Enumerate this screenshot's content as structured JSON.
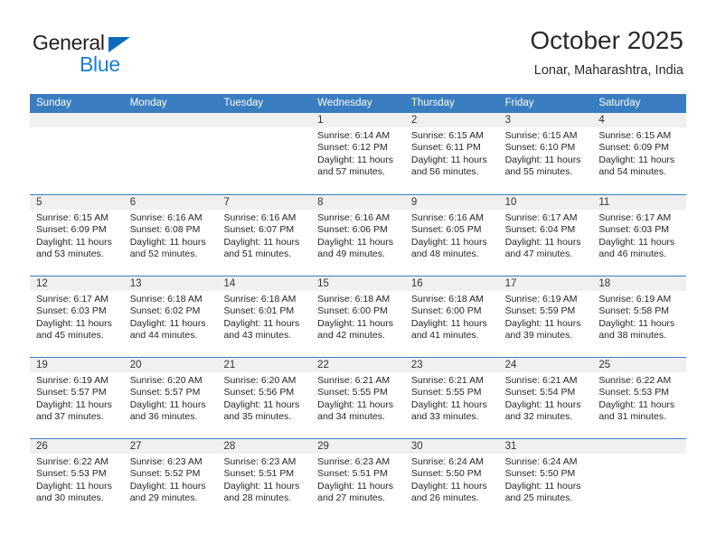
{
  "brand": {
    "name_top": "General",
    "name_bottom": "Blue",
    "accent_color": "#1a7fd4",
    "triangle_color": "#0d6cb9"
  },
  "header": {
    "title": "October 2025",
    "subtitle": "Lonar, Maharashtra, India"
  },
  "calendar": {
    "header_background": "#3a7dc0",
    "daynum_band_background": "#f0f0f0",
    "weekday_headers": [
      "Sunday",
      "Monday",
      "Tuesday",
      "Wednesday",
      "Thursday",
      "Friday",
      "Saturday"
    ],
    "weeks": [
      [
        {
          "day": "",
          "empty": true,
          "lines": []
        },
        {
          "day": "",
          "empty": true,
          "lines": []
        },
        {
          "day": "",
          "empty": true,
          "lines": []
        },
        {
          "day": "1",
          "empty": false,
          "lines": [
            "Sunrise: 6:14 AM",
            "Sunset: 6:12 PM",
            "Daylight: 11 hours",
            "and 57 minutes."
          ]
        },
        {
          "day": "2",
          "empty": false,
          "lines": [
            "Sunrise: 6:15 AM",
            "Sunset: 6:11 PM",
            "Daylight: 11 hours",
            "and 56 minutes."
          ]
        },
        {
          "day": "3",
          "empty": false,
          "lines": [
            "Sunrise: 6:15 AM",
            "Sunset: 6:10 PM",
            "Daylight: 11 hours",
            "and 55 minutes."
          ]
        },
        {
          "day": "4",
          "empty": false,
          "lines": [
            "Sunrise: 6:15 AM",
            "Sunset: 6:09 PM",
            "Daylight: 11 hours",
            "and 54 minutes."
          ]
        }
      ],
      [
        {
          "day": "5",
          "empty": false,
          "lines": [
            "Sunrise: 6:15 AM",
            "Sunset: 6:09 PM",
            "Daylight: 11 hours",
            "and 53 minutes."
          ]
        },
        {
          "day": "6",
          "empty": false,
          "lines": [
            "Sunrise: 6:16 AM",
            "Sunset: 6:08 PM",
            "Daylight: 11 hours",
            "and 52 minutes."
          ]
        },
        {
          "day": "7",
          "empty": false,
          "lines": [
            "Sunrise: 6:16 AM",
            "Sunset: 6:07 PM",
            "Daylight: 11 hours",
            "and 51 minutes."
          ]
        },
        {
          "day": "8",
          "empty": false,
          "lines": [
            "Sunrise: 6:16 AM",
            "Sunset: 6:06 PM",
            "Daylight: 11 hours",
            "and 49 minutes."
          ]
        },
        {
          "day": "9",
          "empty": false,
          "lines": [
            "Sunrise: 6:16 AM",
            "Sunset: 6:05 PM",
            "Daylight: 11 hours",
            "and 48 minutes."
          ]
        },
        {
          "day": "10",
          "empty": false,
          "lines": [
            "Sunrise: 6:17 AM",
            "Sunset: 6:04 PM",
            "Daylight: 11 hours",
            "and 47 minutes."
          ]
        },
        {
          "day": "11",
          "empty": false,
          "lines": [
            "Sunrise: 6:17 AM",
            "Sunset: 6:03 PM",
            "Daylight: 11 hours",
            "and 46 minutes."
          ]
        }
      ],
      [
        {
          "day": "12",
          "empty": false,
          "lines": [
            "Sunrise: 6:17 AM",
            "Sunset: 6:03 PM",
            "Daylight: 11 hours",
            "and 45 minutes."
          ]
        },
        {
          "day": "13",
          "empty": false,
          "lines": [
            "Sunrise: 6:18 AM",
            "Sunset: 6:02 PM",
            "Daylight: 11 hours",
            "and 44 minutes."
          ]
        },
        {
          "day": "14",
          "empty": false,
          "lines": [
            "Sunrise: 6:18 AM",
            "Sunset: 6:01 PM",
            "Daylight: 11 hours",
            "and 43 minutes."
          ]
        },
        {
          "day": "15",
          "empty": false,
          "lines": [
            "Sunrise: 6:18 AM",
            "Sunset: 6:00 PM",
            "Daylight: 11 hours",
            "and 42 minutes."
          ]
        },
        {
          "day": "16",
          "empty": false,
          "lines": [
            "Sunrise: 6:18 AM",
            "Sunset: 6:00 PM",
            "Daylight: 11 hours",
            "and 41 minutes."
          ]
        },
        {
          "day": "17",
          "empty": false,
          "lines": [
            "Sunrise: 6:19 AM",
            "Sunset: 5:59 PM",
            "Daylight: 11 hours",
            "and 39 minutes."
          ]
        },
        {
          "day": "18",
          "empty": false,
          "lines": [
            "Sunrise: 6:19 AM",
            "Sunset: 5:58 PM",
            "Daylight: 11 hours",
            "and 38 minutes."
          ]
        }
      ],
      [
        {
          "day": "19",
          "empty": false,
          "lines": [
            "Sunrise: 6:19 AM",
            "Sunset: 5:57 PM",
            "Daylight: 11 hours",
            "and 37 minutes."
          ]
        },
        {
          "day": "20",
          "empty": false,
          "lines": [
            "Sunrise: 6:20 AM",
            "Sunset: 5:57 PM",
            "Daylight: 11 hours",
            "and 36 minutes."
          ]
        },
        {
          "day": "21",
          "empty": false,
          "lines": [
            "Sunrise: 6:20 AM",
            "Sunset: 5:56 PM",
            "Daylight: 11 hours",
            "and 35 minutes."
          ]
        },
        {
          "day": "22",
          "empty": false,
          "lines": [
            "Sunrise: 6:21 AM",
            "Sunset: 5:55 PM",
            "Daylight: 11 hours",
            "and 34 minutes."
          ]
        },
        {
          "day": "23",
          "empty": false,
          "lines": [
            "Sunrise: 6:21 AM",
            "Sunset: 5:55 PM",
            "Daylight: 11 hours",
            "and 33 minutes."
          ]
        },
        {
          "day": "24",
          "empty": false,
          "lines": [
            "Sunrise: 6:21 AM",
            "Sunset: 5:54 PM",
            "Daylight: 11 hours",
            "and 32 minutes."
          ]
        },
        {
          "day": "25",
          "empty": false,
          "lines": [
            "Sunrise: 6:22 AM",
            "Sunset: 5:53 PM",
            "Daylight: 11 hours",
            "and 31 minutes."
          ]
        }
      ],
      [
        {
          "day": "26",
          "empty": false,
          "lines": [
            "Sunrise: 6:22 AM",
            "Sunset: 5:53 PM",
            "Daylight: 11 hours",
            "and 30 minutes."
          ]
        },
        {
          "day": "27",
          "empty": false,
          "lines": [
            "Sunrise: 6:23 AM",
            "Sunset: 5:52 PM",
            "Daylight: 11 hours",
            "and 29 minutes."
          ]
        },
        {
          "day": "28",
          "empty": false,
          "lines": [
            "Sunrise: 6:23 AM",
            "Sunset: 5:51 PM",
            "Daylight: 11 hours",
            "and 28 minutes."
          ]
        },
        {
          "day": "29",
          "empty": false,
          "lines": [
            "Sunrise: 6:23 AM",
            "Sunset: 5:51 PM",
            "Daylight: 11 hours",
            "and 27 minutes."
          ]
        },
        {
          "day": "30",
          "empty": false,
          "lines": [
            "Sunrise: 6:24 AM",
            "Sunset: 5:50 PM",
            "Daylight: 11 hours",
            "and 26 minutes."
          ]
        },
        {
          "day": "31",
          "empty": false,
          "lines": [
            "Sunrise: 6:24 AM",
            "Sunset: 5:50 PM",
            "Daylight: 11 hours",
            "and 25 minutes."
          ]
        },
        {
          "day": "",
          "empty": true,
          "lines": []
        }
      ]
    ]
  }
}
